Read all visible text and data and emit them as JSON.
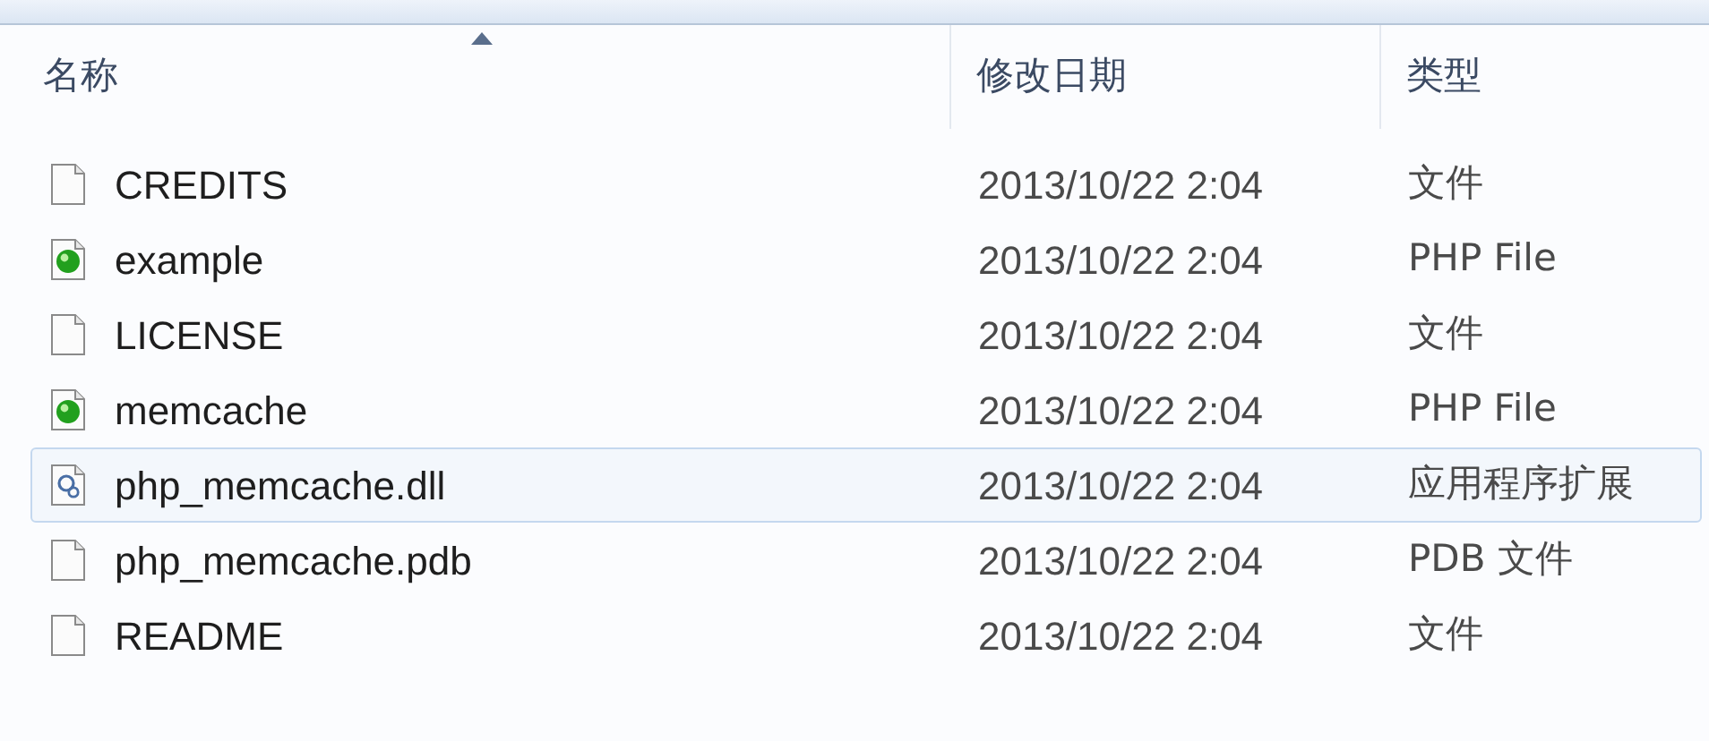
{
  "columns": [
    {
      "label": "名称",
      "sorted": true
    },
    {
      "label": "修改日期",
      "sorted": false
    },
    {
      "label": "类型",
      "sorted": false
    }
  ],
  "rows": [
    {
      "kind": "blank",
      "name": "CREDITS",
      "date": "2013/10/22 2:04",
      "type": "文件",
      "selected": false
    },
    {
      "kind": "php",
      "name": "example",
      "date": "2013/10/22 2:04",
      "type": "PHP File",
      "selected": false
    },
    {
      "kind": "blank",
      "name": "LICENSE",
      "date": "2013/10/22 2:04",
      "type": "文件",
      "selected": false
    },
    {
      "kind": "php",
      "name": "memcache",
      "date": "2013/10/22 2:04",
      "type": "PHP File",
      "selected": false
    },
    {
      "kind": "dll",
      "name": "php_memcache.dll",
      "date": "2013/10/22 2:04",
      "type": "应用程序扩展",
      "selected": true
    },
    {
      "kind": "blank",
      "name": "php_memcache.pdb",
      "date": "2013/10/22 2:04",
      "type": "PDB 文件",
      "selected": false
    },
    {
      "kind": "blank",
      "name": "README",
      "date": "2013/10/22 2:04",
      "type": "文件",
      "selected": false
    }
  ]
}
